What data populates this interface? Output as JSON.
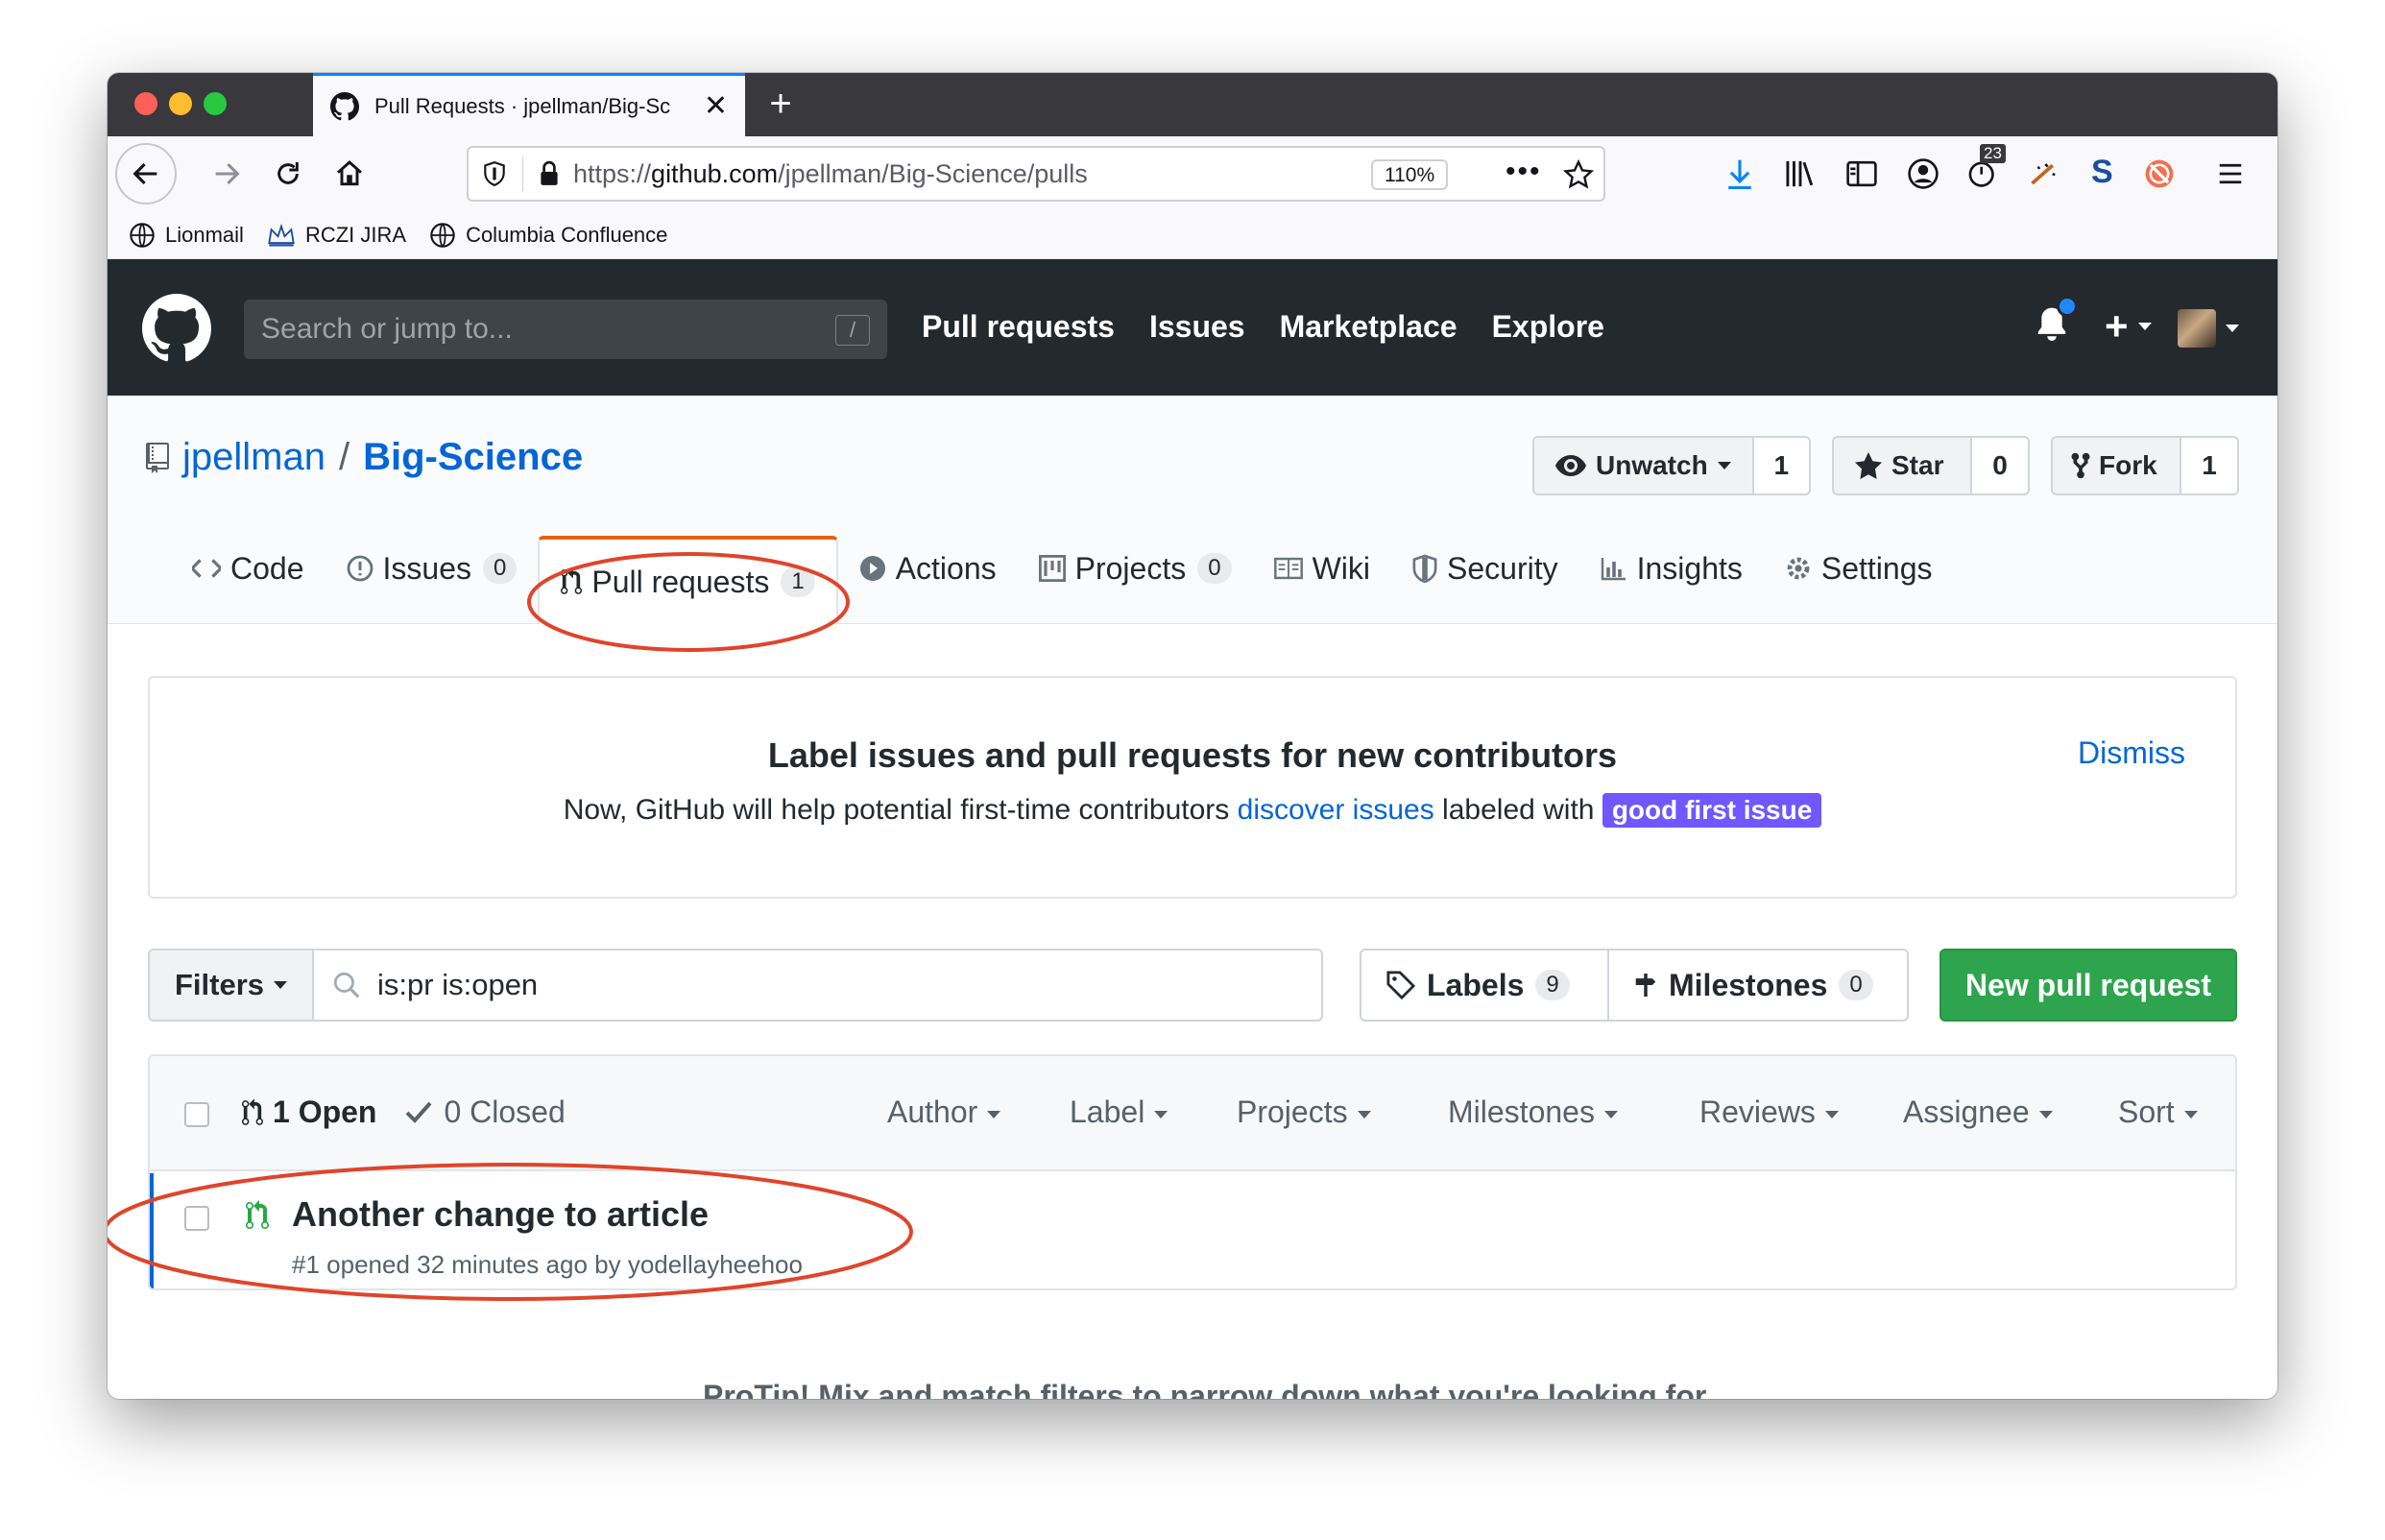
{
  "browser": {
    "tab_title": "Pull Requests · jpellman/Big-Sc",
    "url_prefix": "https://",
    "url_domain": "github.com",
    "url_path": "/jpellman/Big-Science/pulls",
    "zoom": "110%",
    "badge_count": "23",
    "bookmarks": [
      "Lionmail",
      "RCZI JIRA",
      "Columbia Confluence"
    ]
  },
  "github": {
    "search_placeholder": "Search or jump to...",
    "slash_key": "/",
    "nav": [
      "Pull requests",
      "Issues",
      "Marketplace",
      "Explore"
    ],
    "notification_color": "#2188ff"
  },
  "repo": {
    "owner": "jpellman",
    "separator": "/",
    "name": "Big-Science",
    "unwatch_label": "Unwatch",
    "watch_count": "1",
    "star_label": "Star",
    "star_count": "0",
    "fork_label": "Fork",
    "fork_count": "1",
    "tabs": [
      {
        "label": "Code",
        "count": ""
      },
      {
        "label": "Issues",
        "count": "0"
      },
      {
        "label": "Pull requests",
        "count": "1"
      },
      {
        "label": "Actions",
        "count": ""
      },
      {
        "label": "Projects",
        "count": "0"
      },
      {
        "label": "Wiki",
        "count": ""
      },
      {
        "label": "Security",
        "count": ""
      },
      {
        "label": "Insights",
        "count": ""
      },
      {
        "label": "Settings",
        "count": ""
      }
    ]
  },
  "banner": {
    "title": "Label issues and pull requests for new contributors",
    "text_before": "Now, GitHub will help potential first-time contributors ",
    "link": "discover issues",
    "text_after": " labeled with ",
    "label_chip": "good first issue",
    "label_color": "#7057ff",
    "dismiss": "Dismiss"
  },
  "toolbar": {
    "filters_label": "Filters",
    "search_value": "is:pr is:open",
    "labels_label": "Labels",
    "labels_count": "9",
    "milestones_label": "Milestones",
    "milestones_count": "0",
    "new_pr_label": "New pull request",
    "new_pr_color": "#2ea44f"
  },
  "list": {
    "open_label": "1 Open",
    "closed_label": "0 Closed",
    "columns": [
      "Author",
      "Label",
      "Projects",
      "Milestones",
      "Reviews",
      "Assignee",
      "Sort"
    ],
    "items": [
      {
        "title": "Another change to article",
        "meta": "#1 opened 32 minutes ago by yodellayheehoo"
      }
    ]
  },
  "footer": {
    "protip": "ProTip! Mix and match filters to narrow down what you're looking for."
  },
  "annotation_color": "#e0442a"
}
